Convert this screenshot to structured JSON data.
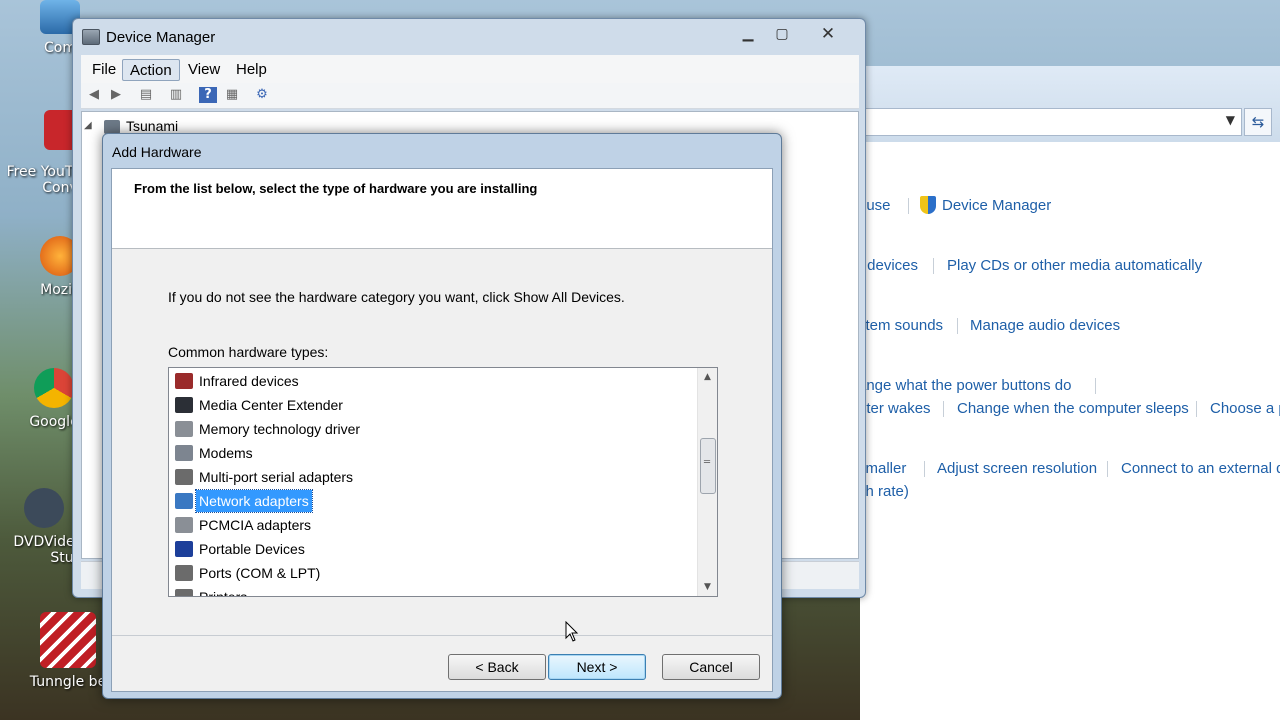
{
  "desktop_icons": [
    {
      "label": "Com"
    },
    {
      "label": "Free YouT"
    },
    {
      "label": "Conv"
    },
    {
      "label": "Mozill"
    },
    {
      "label": "Google"
    },
    {
      "label": "DVDVide"
    },
    {
      "label": "Stu"
    },
    {
      "label": "Tunngle be"
    }
  ],
  "control_panel": {
    "links": [
      {
        "text": "ouse"
      },
      {
        "text": "Device Manager"
      },
      {
        "text": "r devices"
      },
      {
        "text": "Play CDs or other media automatically"
      },
      {
        "text": "stem sounds"
      },
      {
        "text": "Manage audio devices"
      },
      {
        "text": "ange what the power buttons do"
      },
      {
        "text": "uter wakes"
      },
      {
        "text": "Change when the computer sleeps"
      },
      {
        "text": "Choose a p"
      },
      {
        "text": "smaller"
      },
      {
        "text": "Adjust screen resolution"
      },
      {
        "text": "Connect to an external d"
      },
      {
        "text": "sh rate)"
      }
    ]
  },
  "device_manager": {
    "title": "Device Manager",
    "menu": [
      "File",
      "Action",
      "View",
      "Help"
    ],
    "active_menu": "Action",
    "tree_root": "Tsunami"
  },
  "wizard": {
    "title": "Add Hardware",
    "heading": "From the list below, select the type of hardware you are installing",
    "instruction": "If you do not see the hardware category you want, click Show All Devices.",
    "list_label": "Common hardware types:",
    "items": [
      {
        "label": "Infrared devices",
        "icon": "infrared-icon",
        "color": "#9a2b2b"
      },
      {
        "label": "Media Center Extender",
        "icon": "monitor-icon",
        "color": "#2b2f36"
      },
      {
        "label": "Memory technology driver",
        "icon": "card-reader-icon",
        "color": "#8a8f96"
      },
      {
        "label": "Modems",
        "icon": "modem-icon",
        "color": "#7d8590"
      },
      {
        "label": "Multi-port serial adapters",
        "icon": "serial-port-icon",
        "color": "#6b6b6b"
      },
      {
        "label": "Network adapters",
        "icon": "network-icon",
        "color": "#3a78c2",
        "selected": true
      },
      {
        "label": "PCMCIA adapters",
        "icon": "pcmcia-icon",
        "color": "#8a8f96"
      },
      {
        "label": "Portable Devices",
        "icon": "portable-device-icon",
        "color": "#1d3f9a"
      },
      {
        "label": "Ports (COM & LPT)",
        "icon": "port-icon",
        "color": "#6b6b6b"
      },
      {
        "label": "Printers",
        "icon": "printer-icon",
        "color": "#6b6b6b"
      }
    ],
    "buttons": {
      "back": "< Back",
      "next": "Next >",
      "cancel": "Cancel"
    }
  }
}
